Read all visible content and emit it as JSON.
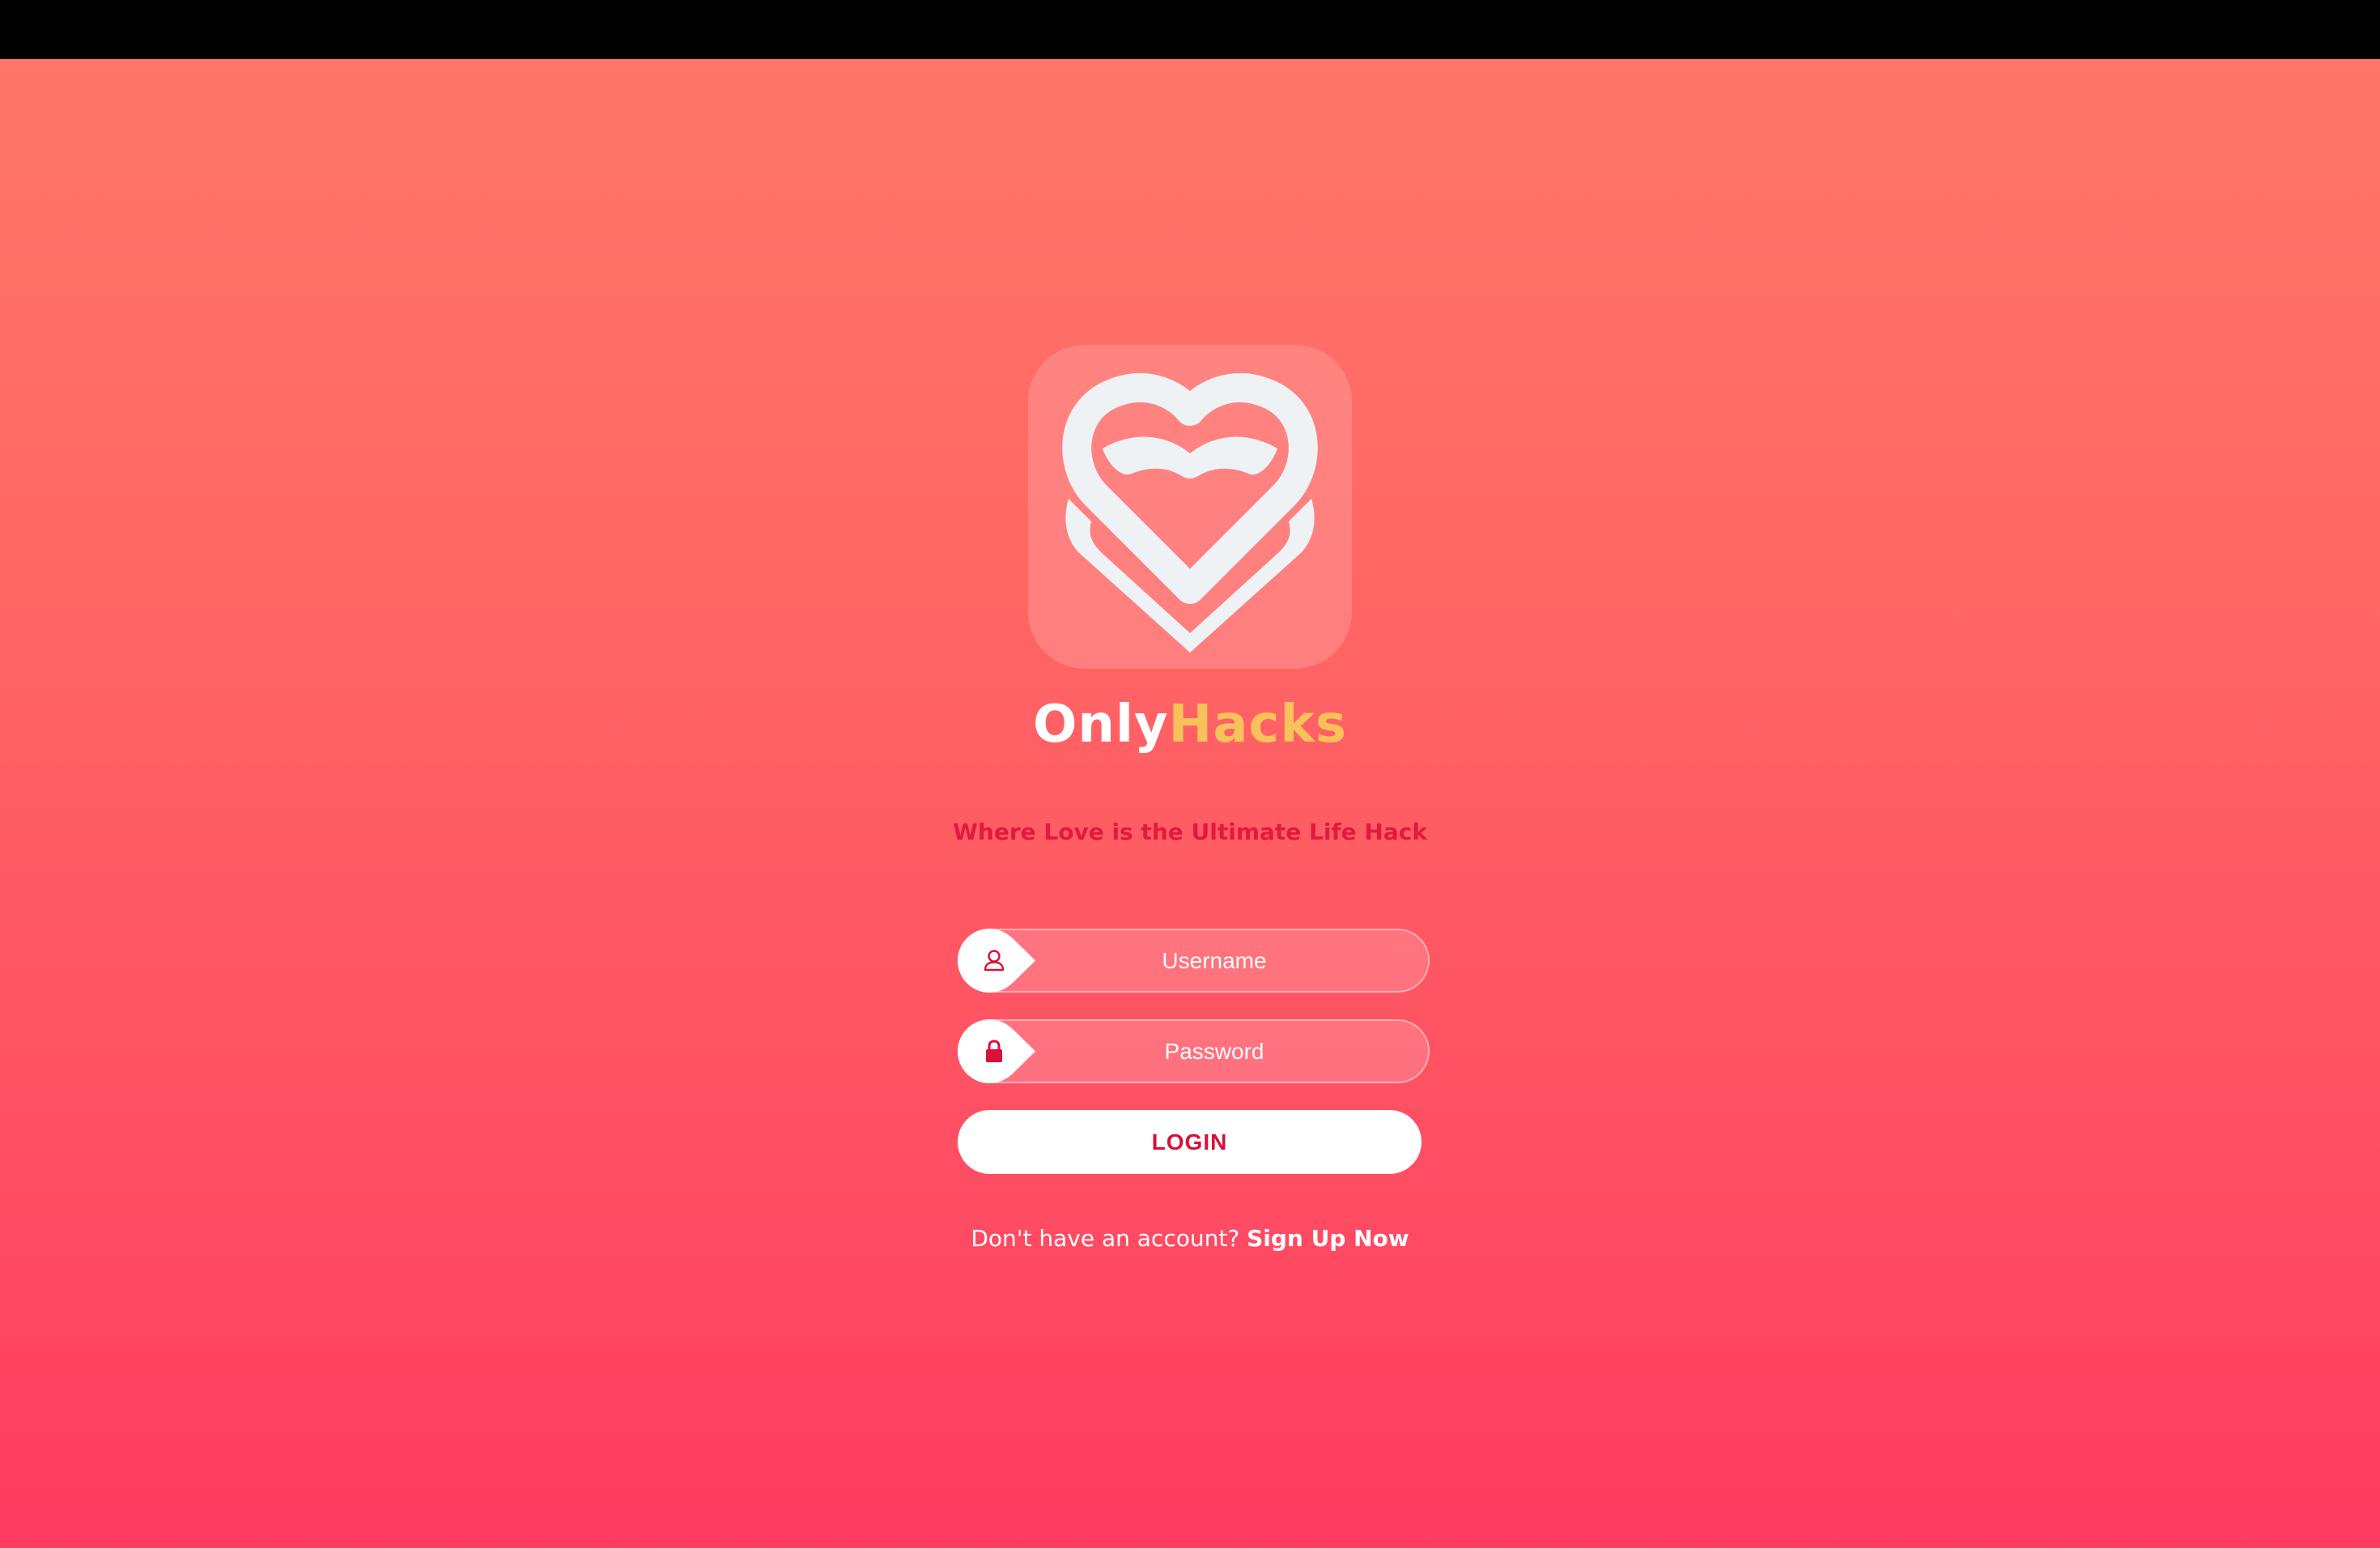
{
  "brand": {
    "name_part_1": "Only",
    "name_part_2": "Hacks",
    "tagline": "Where Love is the Ultimate Life Hack",
    "logo_icon": "heart-logo-icon"
  },
  "login_form": {
    "username_placeholder": "Username",
    "password_placeholder": "Password",
    "username_icon": "user-icon",
    "password_icon": "lock-icon",
    "login_label": "LOGIN"
  },
  "signup": {
    "prompt": "Don't have an account?",
    "link_label": "Sign Up Now"
  },
  "colors": {
    "background_top": "#ff7769",
    "background_bottom": "#ff3b62",
    "accent_red": "#d8113a",
    "accent_gold": "#f8c25a",
    "white": "#ffffff"
  }
}
